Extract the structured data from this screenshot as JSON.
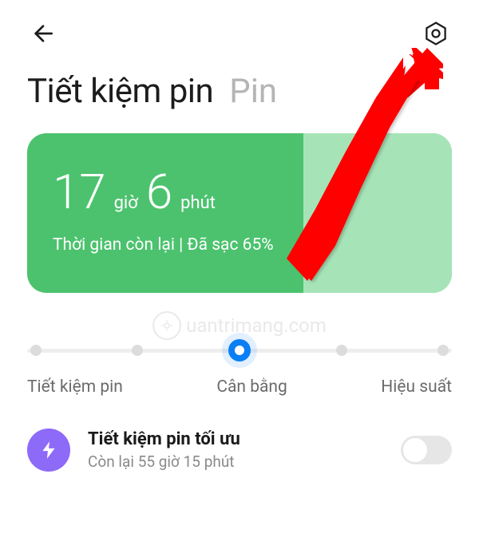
{
  "header": {
    "title_active": "Tiết kiệm pin",
    "title_inactive": "Pin"
  },
  "battery_card": {
    "hours": "17",
    "hours_unit": "giờ",
    "minutes": "6",
    "minutes_unit": "phút",
    "status": "Thời gian còn lại | Đã sạc 65%"
  },
  "slider": {
    "labels": {
      "left": "Tiết kiệm pin",
      "center": "Cân bằng",
      "right": "Hiệu suất"
    }
  },
  "option": {
    "title": "Tiết kiệm pin tối ưu",
    "subtitle": "Còn lại 55 giờ 15 phút"
  },
  "watermark": {
    "text": "uantrimang.com"
  }
}
